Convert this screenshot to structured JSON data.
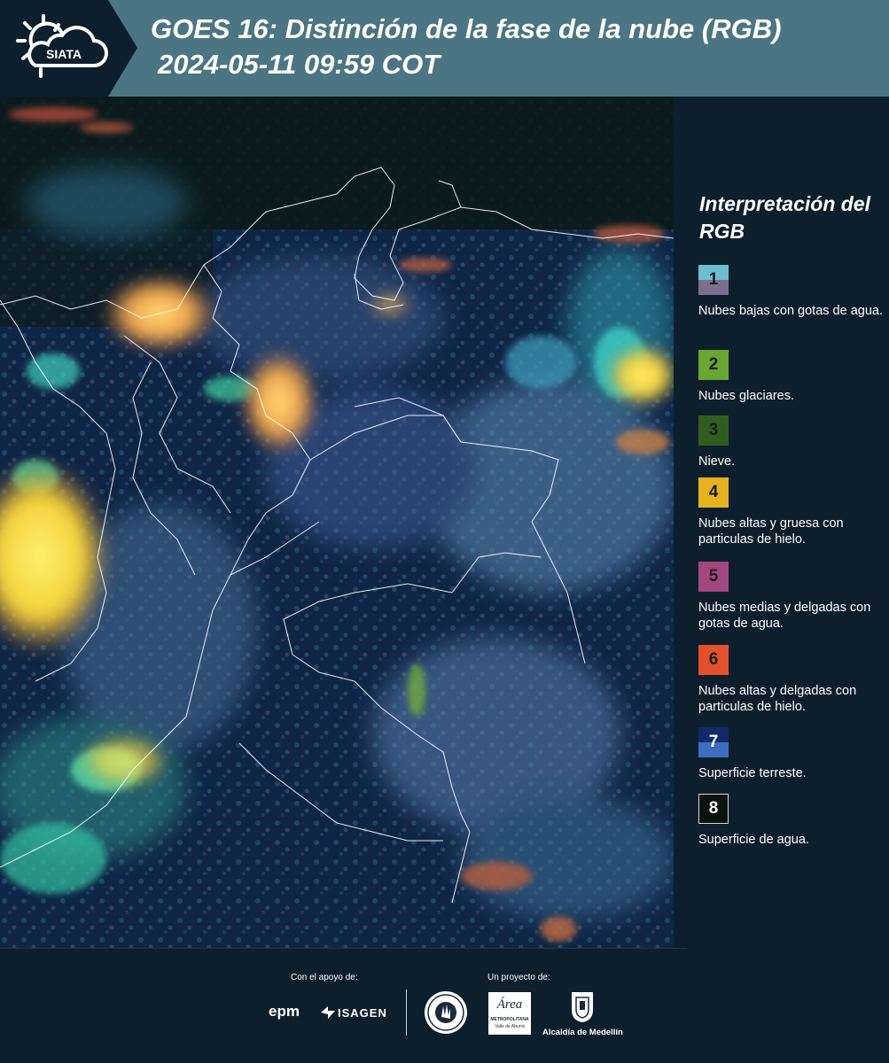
{
  "header": {
    "logo_text": "SIATA",
    "title_line1": "GOES 16: Distinción de la fase de la nube (RGB)",
    "title_line2": "2024-05-11 09:59 COT"
  },
  "sidebar": {
    "title": "Interpretación del RGB",
    "legend": [
      {
        "num": "1",
        "label": "Nubes bajas con gotas de agua.",
        "color_top": "#6cbfcc",
        "color_bottom": "#7c6f8d"
      },
      {
        "num": "2",
        "label": "Nubes glaciares.",
        "color": "#6aa632"
      },
      {
        "num": "3",
        "label": "Nieve.",
        "color": "#2f5e1f"
      },
      {
        "num": "4",
        "label": "Nubes altas y gruesa con particulas de hielo.",
        "color": "#e6b21f"
      },
      {
        "num": "5",
        "label": "Nubes medias y delgadas con gotas de agua.",
        "color": "#a3477f"
      },
      {
        "num": "6",
        "label": "Nubes altas y delgadas con particulas de hielo.",
        "color": "#e2502c"
      },
      {
        "num": "7",
        "label": "Superficie terreste.",
        "color_top": "#102a6a",
        "color_bottom": "#3e6dbe"
      },
      {
        "num": "8",
        "label": "Superficie de agua.",
        "color": "#0a140f"
      }
    ]
  },
  "footer": {
    "support_label": "Con el apoyo de:",
    "project_label": "Un proyecto de:",
    "epm_text": "epm",
    "isagen_text": "ISAGEN",
    "area_text": "Área",
    "metropolitana_text": "METROPOLITANA",
    "valle_text": "Valle de Aburrá",
    "alcaldia_text": "Alcaldía de Medellín"
  }
}
